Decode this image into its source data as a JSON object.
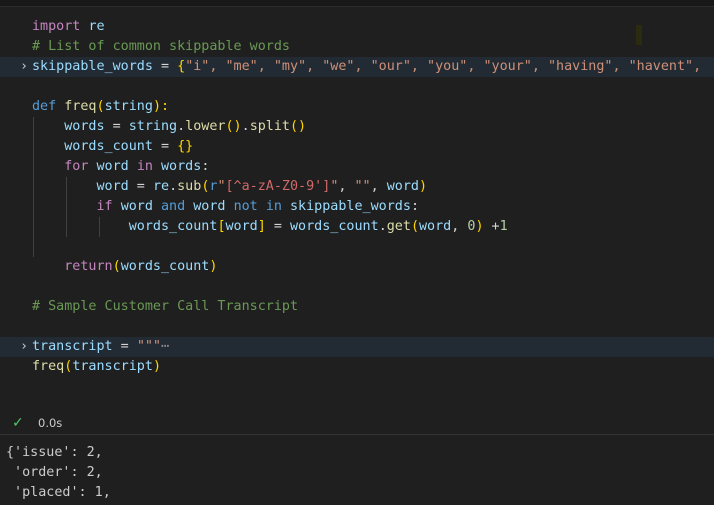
{
  "editor": {
    "tokens": {
      "import_kw": "import",
      "re_mod": "re",
      "comment_list": "# List of common skippable words",
      "skippable_var": "skippable_words",
      "eq": " = ",
      "brace_open": "{",
      "skip_values": "\"i\", \"me\", \"my\", \"we\", \"our\", \"you\", \"your\", \"having\", \"havent\",",
      "def_kw": "def",
      "freq_fn": "freq",
      "paren_open": "(",
      "param_string": "string",
      "paren_close_colon": "):",
      "words_var": "words",
      "string_var": "string",
      "dot": ".",
      "lower_fn": "lower",
      "split_fn": "split",
      "empty_parens": "()",
      "words_count_var": "words_count",
      "empty_braces": "{}",
      "for_kw": "for",
      "word_var": "word",
      "in_kw": "in",
      "colon": ":",
      "re_var": "re",
      "sub_fn": "sub",
      "raw_prefix": "r",
      "regex_open": "\"",
      "regex_body": "[^a-zA-Z0-9']",
      "regex_close": "\"",
      "comma_space": ", ",
      "empty_str": "\"\"",
      "paren_close": ")",
      "if_kw": "if",
      "and_kw": "and",
      "not_kw": "not",
      "bracket_open": "[",
      "bracket_close": "]",
      "get_fn": "get",
      "zero": "0",
      "plus": " +",
      "one": "1",
      "return_kw": "return",
      "comment_sample": "# Sample Customer Call Transcript",
      "transcript_var": "transcript",
      "triple_quote": "\"\"\"",
      "ellipsis": "⋯"
    },
    "fold_icon": "chevron-right"
  },
  "status": {
    "check_icon": "check",
    "duration": "0.0s"
  },
  "output": {
    "lines": [
      "{'issue': 2,",
      " 'order': 2,",
      " 'placed': 1,"
    ]
  },
  "colors": {
    "background": "#1f1f1f",
    "keyword": "#569cd6",
    "control": "#c586c0",
    "function": "#dcdcaa",
    "variable": "#9cdcfe",
    "string": "#ce9178",
    "comment": "#6a9955",
    "success": "#4ec96a"
  }
}
